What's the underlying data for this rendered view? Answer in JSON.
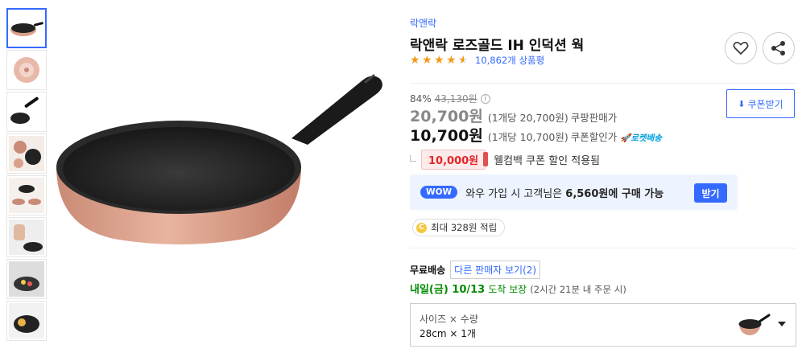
{
  "product": {
    "brand": "락앤락",
    "title": "락앤락 로즈골드 IH 인덕션 웍",
    "rating": 4.5,
    "review_count": "10,862개 상품평"
  },
  "pricing": {
    "discount_rate": "84%",
    "original_price": "43,130원",
    "info_icon": "i",
    "sale_price": "20,700원",
    "sale_unit": "(1개당 20,700원)",
    "sale_type": "쿠팡판매가",
    "coupon_price": "10,700원",
    "coupon_unit": "(1개당 10,700원)",
    "coupon_type": "쿠폰할인가",
    "rocket_label": "로켓배송",
    "welcome_amount": "10,000원",
    "welcome_text": "웰컴백 쿠폰 할인 적용됨",
    "coupon_download_label": "쿠폰받기"
  },
  "wow": {
    "badge": "WOW",
    "text_prefix": "와우 가입 시 고객님은",
    "price": "6,560원",
    "text_suffix": "에 구매 가능",
    "button": "받기"
  },
  "points": {
    "coin": "C",
    "text": "최대 328원 적립"
  },
  "shipping": {
    "free_label": "무료배송",
    "other_sellers": "다른 판매자 보기(2)",
    "delivery_date": "내일(금) 10/13",
    "guarantee": "도착 보장",
    "order_by": "(2시간 21분 내 주문 시)"
  },
  "option": {
    "label": "사이즈 × 수량",
    "value": "28cm × 1개"
  },
  "icons": {
    "wishlist": "heart-icon",
    "share": "share-icon",
    "download": "download-icon",
    "dropdown": "caret-down-icon"
  },
  "colors": {
    "accent": "#346aff",
    "star": "#f39a19",
    "coupon_red": "#e52528",
    "delivery_green": "#008c00",
    "pan_rose_gold": "#d9a08a"
  },
  "thumbnails": [
    {
      "name": "thumb-1",
      "active": true
    },
    {
      "name": "thumb-2",
      "active": false
    },
    {
      "name": "thumb-3",
      "active": false
    },
    {
      "name": "thumb-4",
      "active": false
    },
    {
      "name": "thumb-5",
      "active": false
    },
    {
      "name": "thumb-6",
      "active": false
    },
    {
      "name": "thumb-7",
      "active": false
    },
    {
      "name": "thumb-8",
      "active": false
    }
  ]
}
